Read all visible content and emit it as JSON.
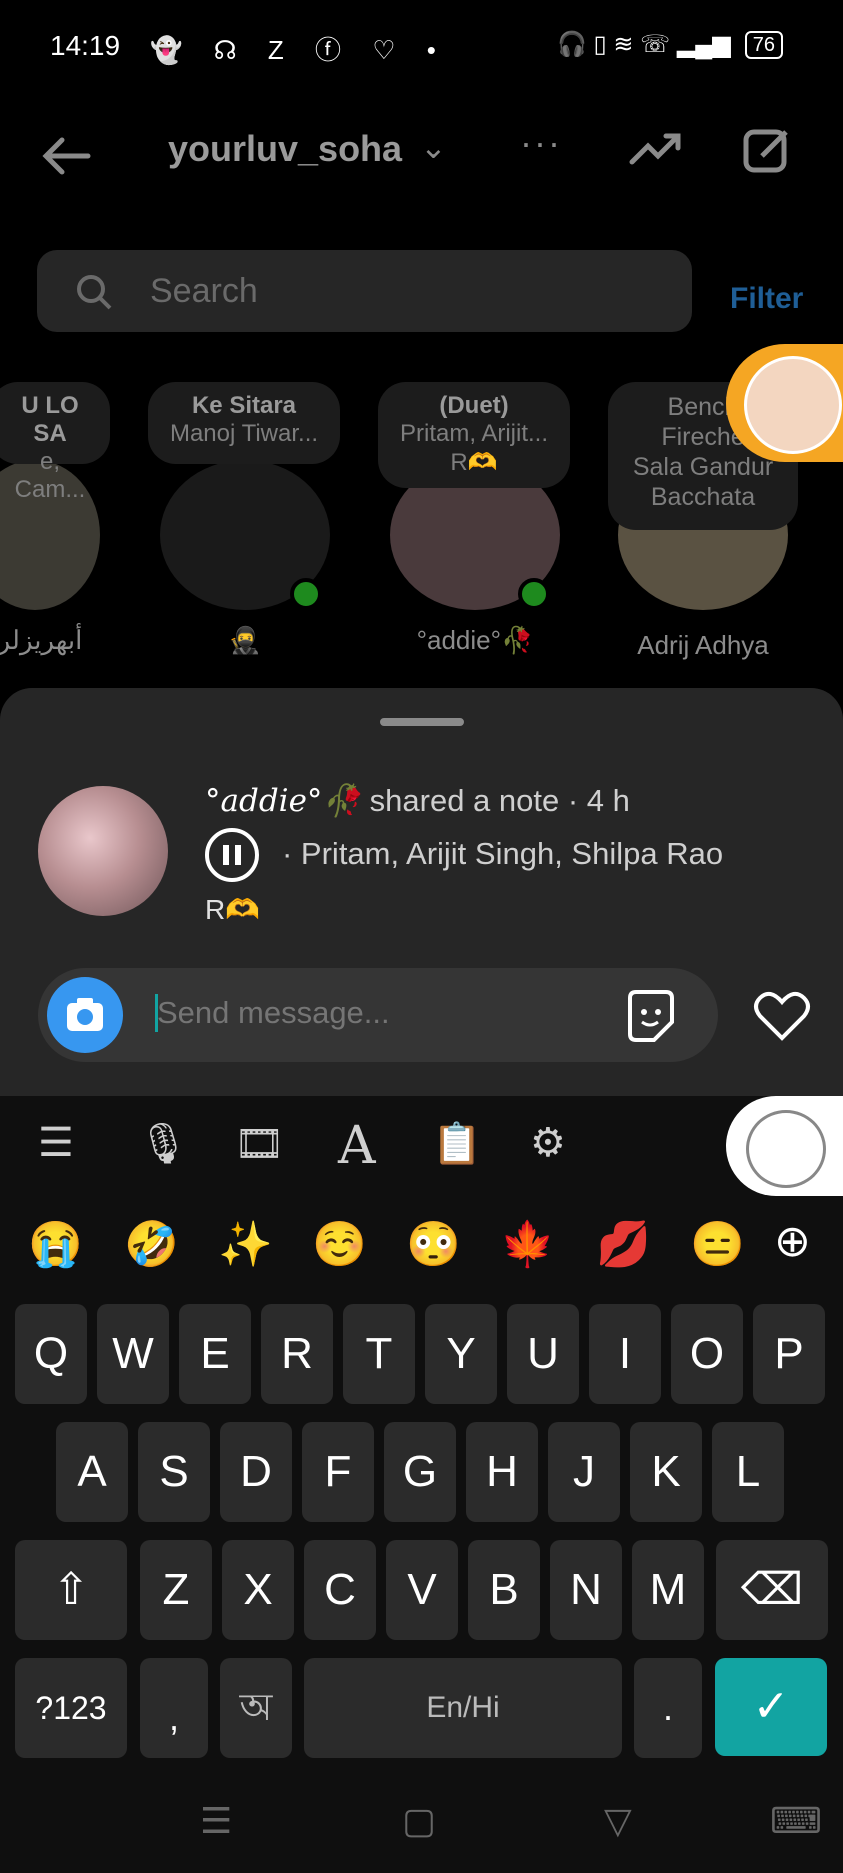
{
  "status_bar": {
    "time": "14:19",
    "left_icons": "👻 ☊ Z ⓕ ♡ •",
    "right_icons": "🎧 ▯ ≋ ☏ ▂▄▆",
    "battery": "76"
  },
  "header": {
    "username": "yourluv_soha",
    "back_icon": "arrow-left-icon",
    "more_icon": "ellipsis-icon",
    "trend_icon": "trending-icon",
    "compose_icon": "compose-icon"
  },
  "search": {
    "placeholder": "Search",
    "filter_label": "Filter"
  },
  "notes": [
    {
      "line1": "U LO SA",
      "line2": "e, Cam...",
      "name": "أبهريزلر"
    },
    {
      "line1": "Ke Sitara",
      "line2": "Manoj Tiwar...",
      "name": "🥷"
    },
    {
      "line1": "(Duet)",
      "line2": "Pritam, Arijit...",
      "line3": "R🫶",
      "name": "°addie°🥀"
    },
    {
      "line1": "Bench",
      "line2": "Fireche",
      "line3": "Sala Gandur",
      "line4": "Bacchata",
      "name": "Adrij Adhya"
    }
  ],
  "sheet": {
    "author": "°addie°🥀",
    "shared_text": "shared a note · 4 h",
    "song_artists": "· Pritam, Arijit Singh, Shilpa Rao",
    "note_text": "R🫶",
    "message_placeholder": "Send message..."
  },
  "keyboard": {
    "tools": [
      "☰",
      "🎙",
      "🎞",
      "A",
      "📋",
      "⚙"
    ],
    "emoji_row": [
      "😭",
      "🤣",
      "✨",
      "☺️",
      "😳",
      "🍁",
      "💋",
      "😑",
      "⊕"
    ],
    "row1": [
      "Q",
      "W",
      "E",
      "R",
      "T",
      "Y",
      "U",
      "I",
      "O",
      "P"
    ],
    "row2": [
      "A",
      "S",
      "D",
      "F",
      "G",
      "H",
      "J",
      "K",
      "L"
    ],
    "row3": [
      "Z",
      "X",
      "C",
      "V",
      "B",
      "N",
      "M"
    ],
    "shift": "⇧",
    "backspace": "⌫",
    "numbers": "?123",
    "emoji_comma": ",",
    "lang_key": "অ",
    "space": "En/Hi",
    "period": ".",
    "enter": "✓"
  },
  "navbar": {
    "menu": "☰",
    "home": "▢",
    "back": "▽",
    "keyboard": "⌨"
  },
  "colors": {
    "accent_blue": "#3797f0",
    "teal": "#12a4a2",
    "sheet_bg": "#262626"
  }
}
